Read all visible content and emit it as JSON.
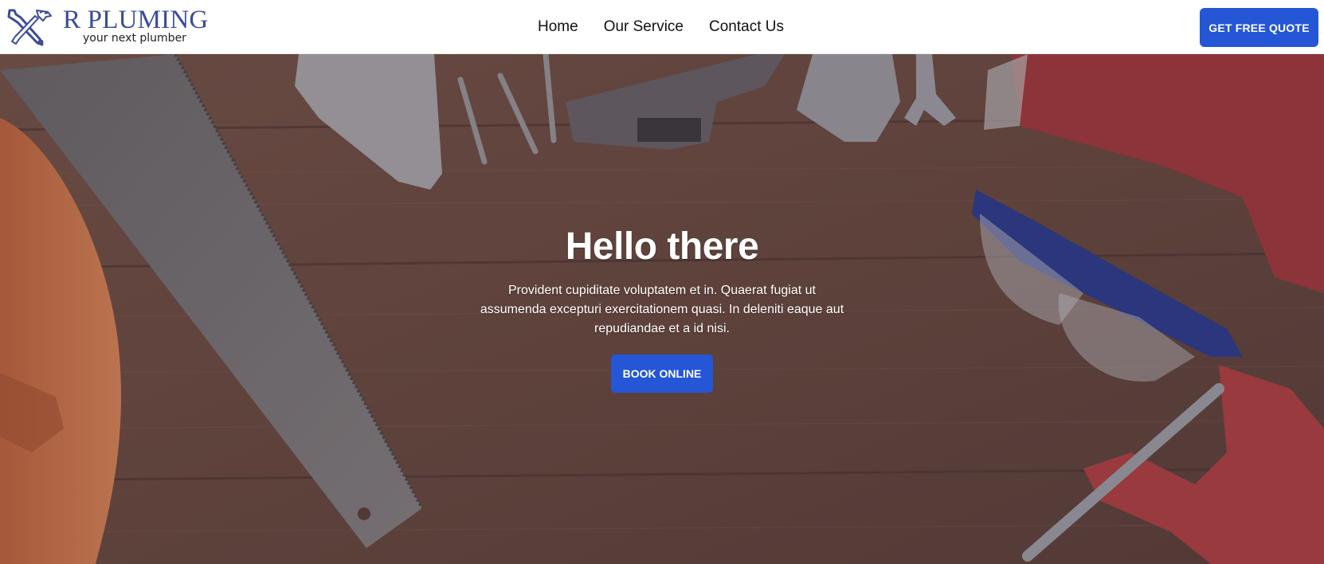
{
  "brand": {
    "name": "R PLUMING",
    "tagline": "your next plumber",
    "color": "#3b4c9a"
  },
  "nav": {
    "items": [
      {
        "label": "Home"
      },
      {
        "label": "Our Service"
      },
      {
        "label": "Contact Us"
      }
    ]
  },
  "header": {
    "cta_label": "GET FREE QUOTE"
  },
  "hero": {
    "title": "Hello there",
    "text": "Provident cupiditate voluptatem et in. Quaerat fugiat ut assumenda excepturi exercitationem quasi. In deleniti eaque aut repudiandae et a id nisi.",
    "cta_label": "BOOK ONLINE",
    "background": "hero-background-tools-on-wood"
  },
  "colors": {
    "accent": "#2456d6",
    "nav_text": "#111111",
    "hero_text": "#ffffff"
  },
  "icons": {
    "logo": "crossed-hammer-wrench-icon"
  }
}
